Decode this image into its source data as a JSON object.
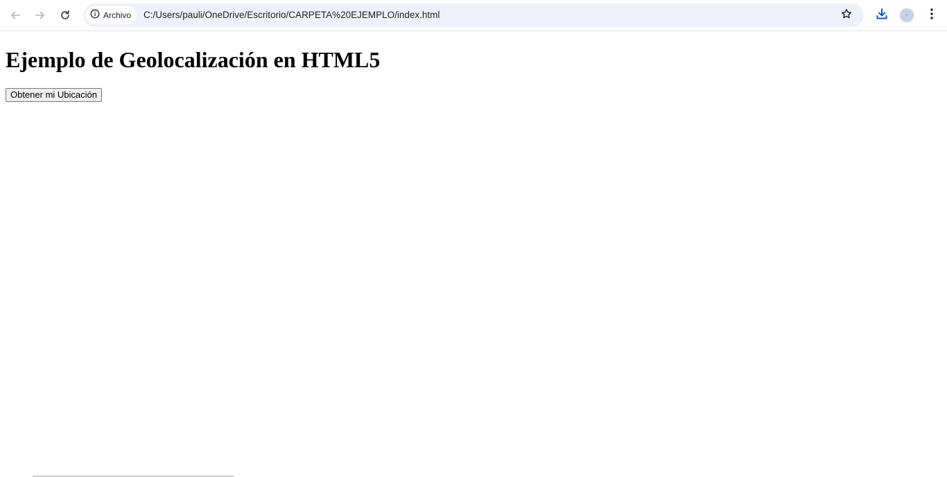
{
  "browser": {
    "back_icon": "arrow-left-icon",
    "forward_icon": "arrow-right-icon",
    "reload_icon": "reload-icon",
    "site_info_icon": "info-circle-icon",
    "site_info_label": "Archivo",
    "url": "C:/Users/pauli/OneDrive/Escritorio/CARPETA%20EJEMPLO/index.html",
    "bookmark_icon": "star-outline-icon",
    "download_icon": "download-icon",
    "profile_icon": "avatar-icon",
    "profile_initial": "-",
    "menu_icon": "kebab-menu-icon",
    "accent_color": "#0b57d0",
    "omnibox_color": "#edf2fa"
  },
  "page": {
    "heading": "Ejemplo de Geolocalización en HTML5",
    "button_label": "Obtener mi Ubicación"
  }
}
